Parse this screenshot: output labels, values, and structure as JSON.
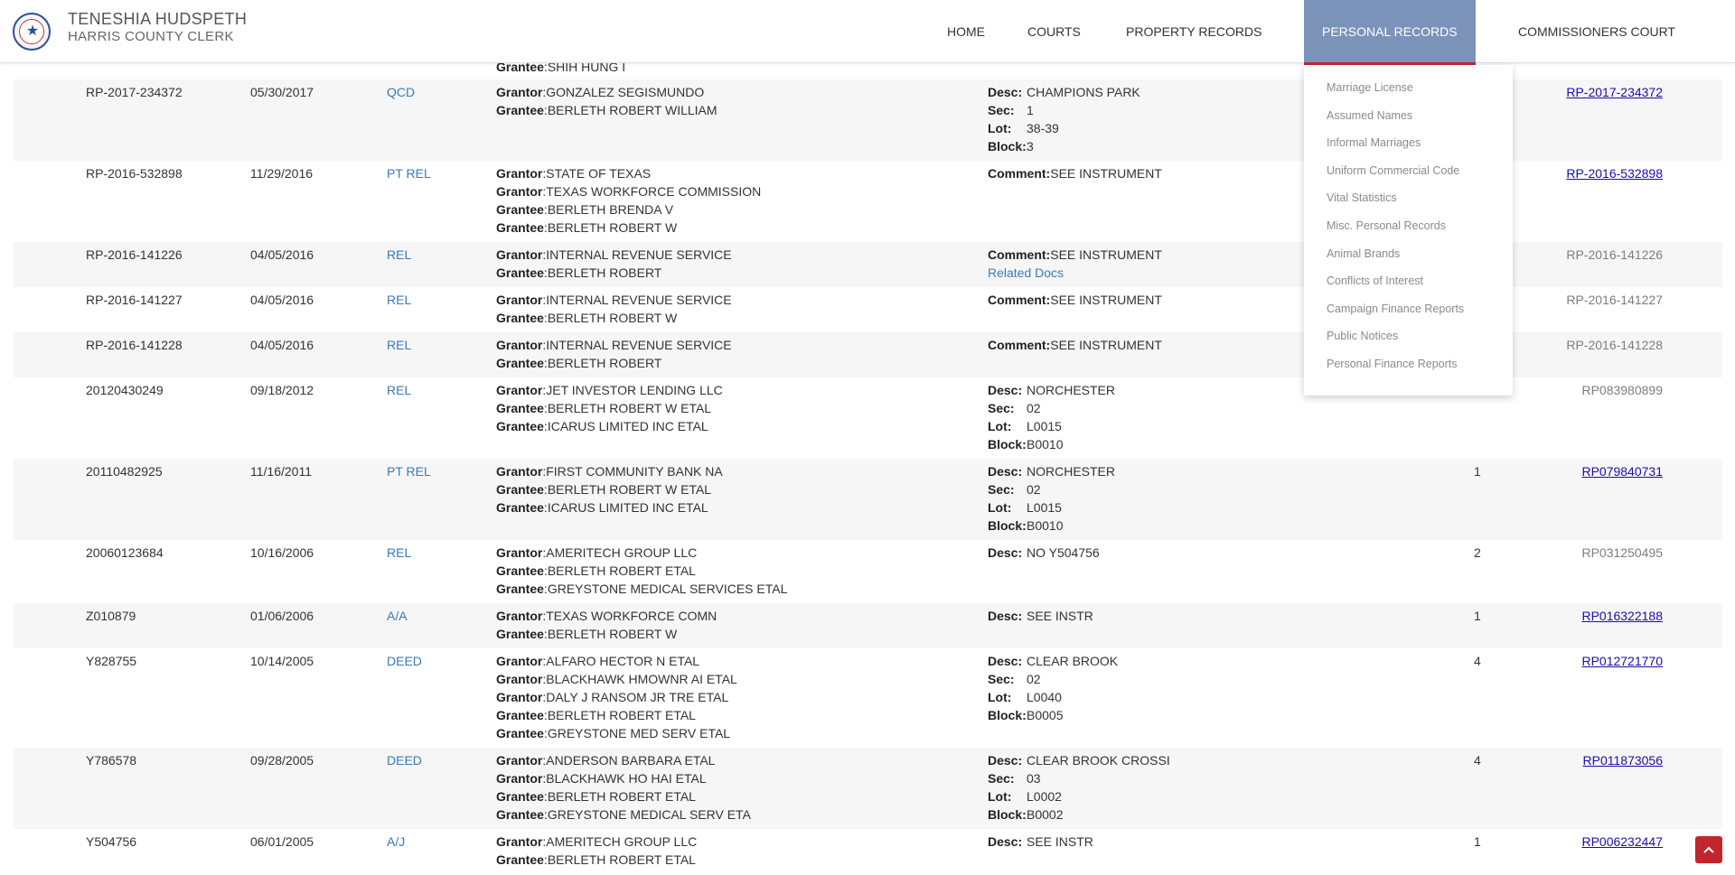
{
  "header": {
    "name": "TENESHIA HUDSPETH",
    "office": "HARRIS COUNTY CLERK"
  },
  "nav": {
    "home": "HOME",
    "courts": "COURTS",
    "property_records": "PROPERTY RECORDS",
    "personal_records": "PERSONAL RECORDS",
    "commissioners_court": "COMMISSIONERS COURT"
  },
  "dropdown": {
    "items": [
      "Marriage License",
      "Assumed Names",
      "Informal Marriages",
      "Uniform Commercial Code",
      "Vital Statistics",
      "Misc. Personal Records",
      "Animal Brands",
      "Conflicts of Interest",
      "Campaign Finance Reports",
      "Public Notices",
      "Personal Finance Reports"
    ]
  },
  "labels": {
    "grantor": "Grantor",
    "grantee": "Grantee",
    "desc": "Desc:",
    "sec": "Sec:",
    "lot": "Lot:",
    "block": "Block:",
    "comment": "Comment:",
    "related_docs": "Related Docs"
  },
  "partial_row": {
    "grantee": "SHIH HUNG I"
  },
  "rows": [
    {
      "file": "RP-2017-234372",
      "date": "05/30/2017",
      "type": "QCD",
      "parties": [
        [
          "Grantor",
          "GONZALEZ SEGISMUNDO"
        ],
        [
          "Grantee",
          "BERLETH ROBERT WILLIAM"
        ]
      ],
      "legal": [
        [
          "Desc:",
          "CHAMPIONS PARK"
        ],
        [
          "Sec:",
          "1"
        ],
        [
          "Lot:",
          "38-39"
        ],
        [
          "Block:",
          "3"
        ]
      ],
      "pages": "",
      "film": "RP-2017-234372",
      "film_link": true
    },
    {
      "file": "RP-2016-532898",
      "date": "11/29/2016",
      "type": "PT REL",
      "parties": [
        [
          "Grantor",
          "STATE OF TEXAS"
        ],
        [
          "Grantor",
          "TEXAS WORKFORCE COMMISSION"
        ],
        [
          "Grantee",
          "BERLETH BRENDA V"
        ],
        [
          "Grantee",
          "BERLETH ROBERT W"
        ]
      ],
      "legal": [
        [
          "Comment:",
          "SEE INSTRUMENT"
        ]
      ],
      "pages": "",
      "film": "RP-2016-532898",
      "film_link": true
    },
    {
      "file": "RP-2016-141226",
      "date": "04/05/2016",
      "type": "REL",
      "parties": [
        [
          "Grantor",
          "INTERNAL REVENUE SERVICE"
        ],
        [
          "Grantee",
          "BERLETH ROBERT"
        ]
      ],
      "legal": [
        [
          "Comment:",
          "SEE INSTRUMENT"
        ]
      ],
      "related": true,
      "pages": "",
      "film": "RP-2016-141226",
      "film_link": false
    },
    {
      "file": "RP-2016-141227",
      "date": "04/05/2016",
      "type": "REL",
      "parties": [
        [
          "Grantor",
          "INTERNAL REVENUE SERVICE"
        ],
        [
          "Grantee",
          "BERLETH ROBERT W"
        ]
      ],
      "legal": [
        [
          "Comment:",
          "SEE INSTRUMENT"
        ]
      ],
      "pages": "",
      "film": "RP-2016-141227",
      "film_link": false
    },
    {
      "file": "RP-2016-141228",
      "date": "04/05/2016",
      "type": "REL",
      "parties": [
        [
          "Grantor",
          "INTERNAL REVENUE SERVICE"
        ],
        [
          "Grantee",
          "BERLETH ROBERT"
        ]
      ],
      "legal": [
        [
          "Comment:",
          "SEE INSTRUMENT"
        ]
      ],
      "pages": "",
      "film": "RP-2016-141228",
      "film_link": false
    },
    {
      "file": "20120430249",
      "date": "09/18/2012",
      "type": "REL",
      "parties": [
        [
          "Grantor",
          "JET INVESTOR LENDING LLC"
        ],
        [
          "Grantee",
          "BERLETH ROBERT W ETAL"
        ],
        [
          "Grantee",
          "ICARUS LIMITED INC ETAL"
        ]
      ],
      "legal": [
        [
          "Desc:",
          "NORCHESTER"
        ],
        [
          "Sec:",
          "02"
        ],
        [
          "Lot:",
          "L0015"
        ],
        [
          "Block:",
          "B0010"
        ]
      ],
      "pages": "",
      "film": "RP083980899",
      "film_link": false
    },
    {
      "file": "20110482925",
      "date": "11/16/2011",
      "type": "PT REL",
      "parties": [
        [
          "Grantor",
          "FIRST COMMUNITY BANK NA"
        ],
        [
          "Grantee",
          "BERLETH ROBERT W ETAL"
        ],
        [
          "Grantee",
          "ICARUS LIMITED INC ETAL"
        ]
      ],
      "legal": [
        [
          "Desc:",
          "NORCHESTER"
        ],
        [
          "Sec:",
          "02"
        ],
        [
          "Lot:",
          "L0015"
        ],
        [
          "Block:",
          "B0010"
        ]
      ],
      "pages": "1",
      "film": "RP079840731",
      "film_link": true
    },
    {
      "file": "20060123684",
      "date": "10/16/2006",
      "type": "REL",
      "parties": [
        [
          "Grantor",
          "AMERITECH GROUP LLC"
        ],
        [
          "Grantee",
          "BERLETH ROBERT ETAL"
        ],
        [
          "Grantee",
          "GREYSTONE MEDICAL SERVICES ETAL"
        ]
      ],
      "legal": [
        [
          "Desc:",
          "NO Y504756"
        ]
      ],
      "pages": "2",
      "film": "RP031250495",
      "film_link": false
    },
    {
      "file": "Z010879",
      "date": "01/06/2006",
      "type": "A/A",
      "parties": [
        [
          "Grantor",
          "TEXAS WORKFORCE COMN"
        ],
        [
          "Grantee",
          "BERLETH ROBERT W"
        ]
      ],
      "legal": [
        [
          "Desc:",
          "SEE INSTR"
        ]
      ],
      "pages": "1",
      "film": "RP016322188",
      "film_link": true
    },
    {
      "file": "Y828755",
      "date": "10/14/2005",
      "type": "DEED",
      "parties": [
        [
          "Grantor",
          "ALFARO HECTOR N ETAL"
        ],
        [
          "Grantor",
          "BLACKHAWK HMOWNR AI ETAL"
        ],
        [
          "Grantor",
          "DALY J RANSOM JR TRE ETAL"
        ],
        [
          "Grantee",
          "BERLETH ROBERT ETAL"
        ],
        [
          "Grantee",
          "GREYSTONE MED SERV ETAL"
        ]
      ],
      "legal": [
        [
          "Desc:",
          "CLEAR BROOK"
        ],
        [
          "Sec:",
          "02"
        ],
        [
          "Lot:",
          "L0040"
        ],
        [
          "Block:",
          "B0005"
        ]
      ],
      "pages": "4",
      "film": "RP012721770",
      "film_link": true
    },
    {
      "file": "Y786578",
      "date": "09/28/2005",
      "type": "DEED",
      "parties": [
        [
          "Grantor",
          "ANDERSON BARBARA ETAL"
        ],
        [
          "Grantor",
          "BLACKHAWK HO HAI ETAL"
        ],
        [
          "Grantee",
          "BERLETH ROBERT ETAL"
        ],
        [
          "Grantee",
          "GREYSTONE MEDICAL SERV ETA"
        ]
      ],
      "legal": [
        [
          "Desc:",
          "CLEAR BROOK CROSSI"
        ],
        [
          "Sec:",
          "03"
        ],
        [
          "Lot:",
          "L0002"
        ],
        [
          "Block:",
          "B0002"
        ]
      ],
      "pages": "4",
      "film": "RP011873056",
      "film_link": true
    },
    {
      "file": "Y504756",
      "date": "06/01/2005",
      "type": "A/J",
      "parties": [
        [
          "Grantor",
          "AMERITECH GROUP LLC"
        ],
        [
          "Grantee",
          "BERLETH ROBERT ETAL"
        ]
      ],
      "legal": [
        [
          "Desc:",
          "SEE INSTR"
        ]
      ],
      "pages": "1",
      "film": "RP006232447",
      "film_link": true
    }
  ],
  "back_to_top": {
    "icon": "chevron-up-icon"
  }
}
